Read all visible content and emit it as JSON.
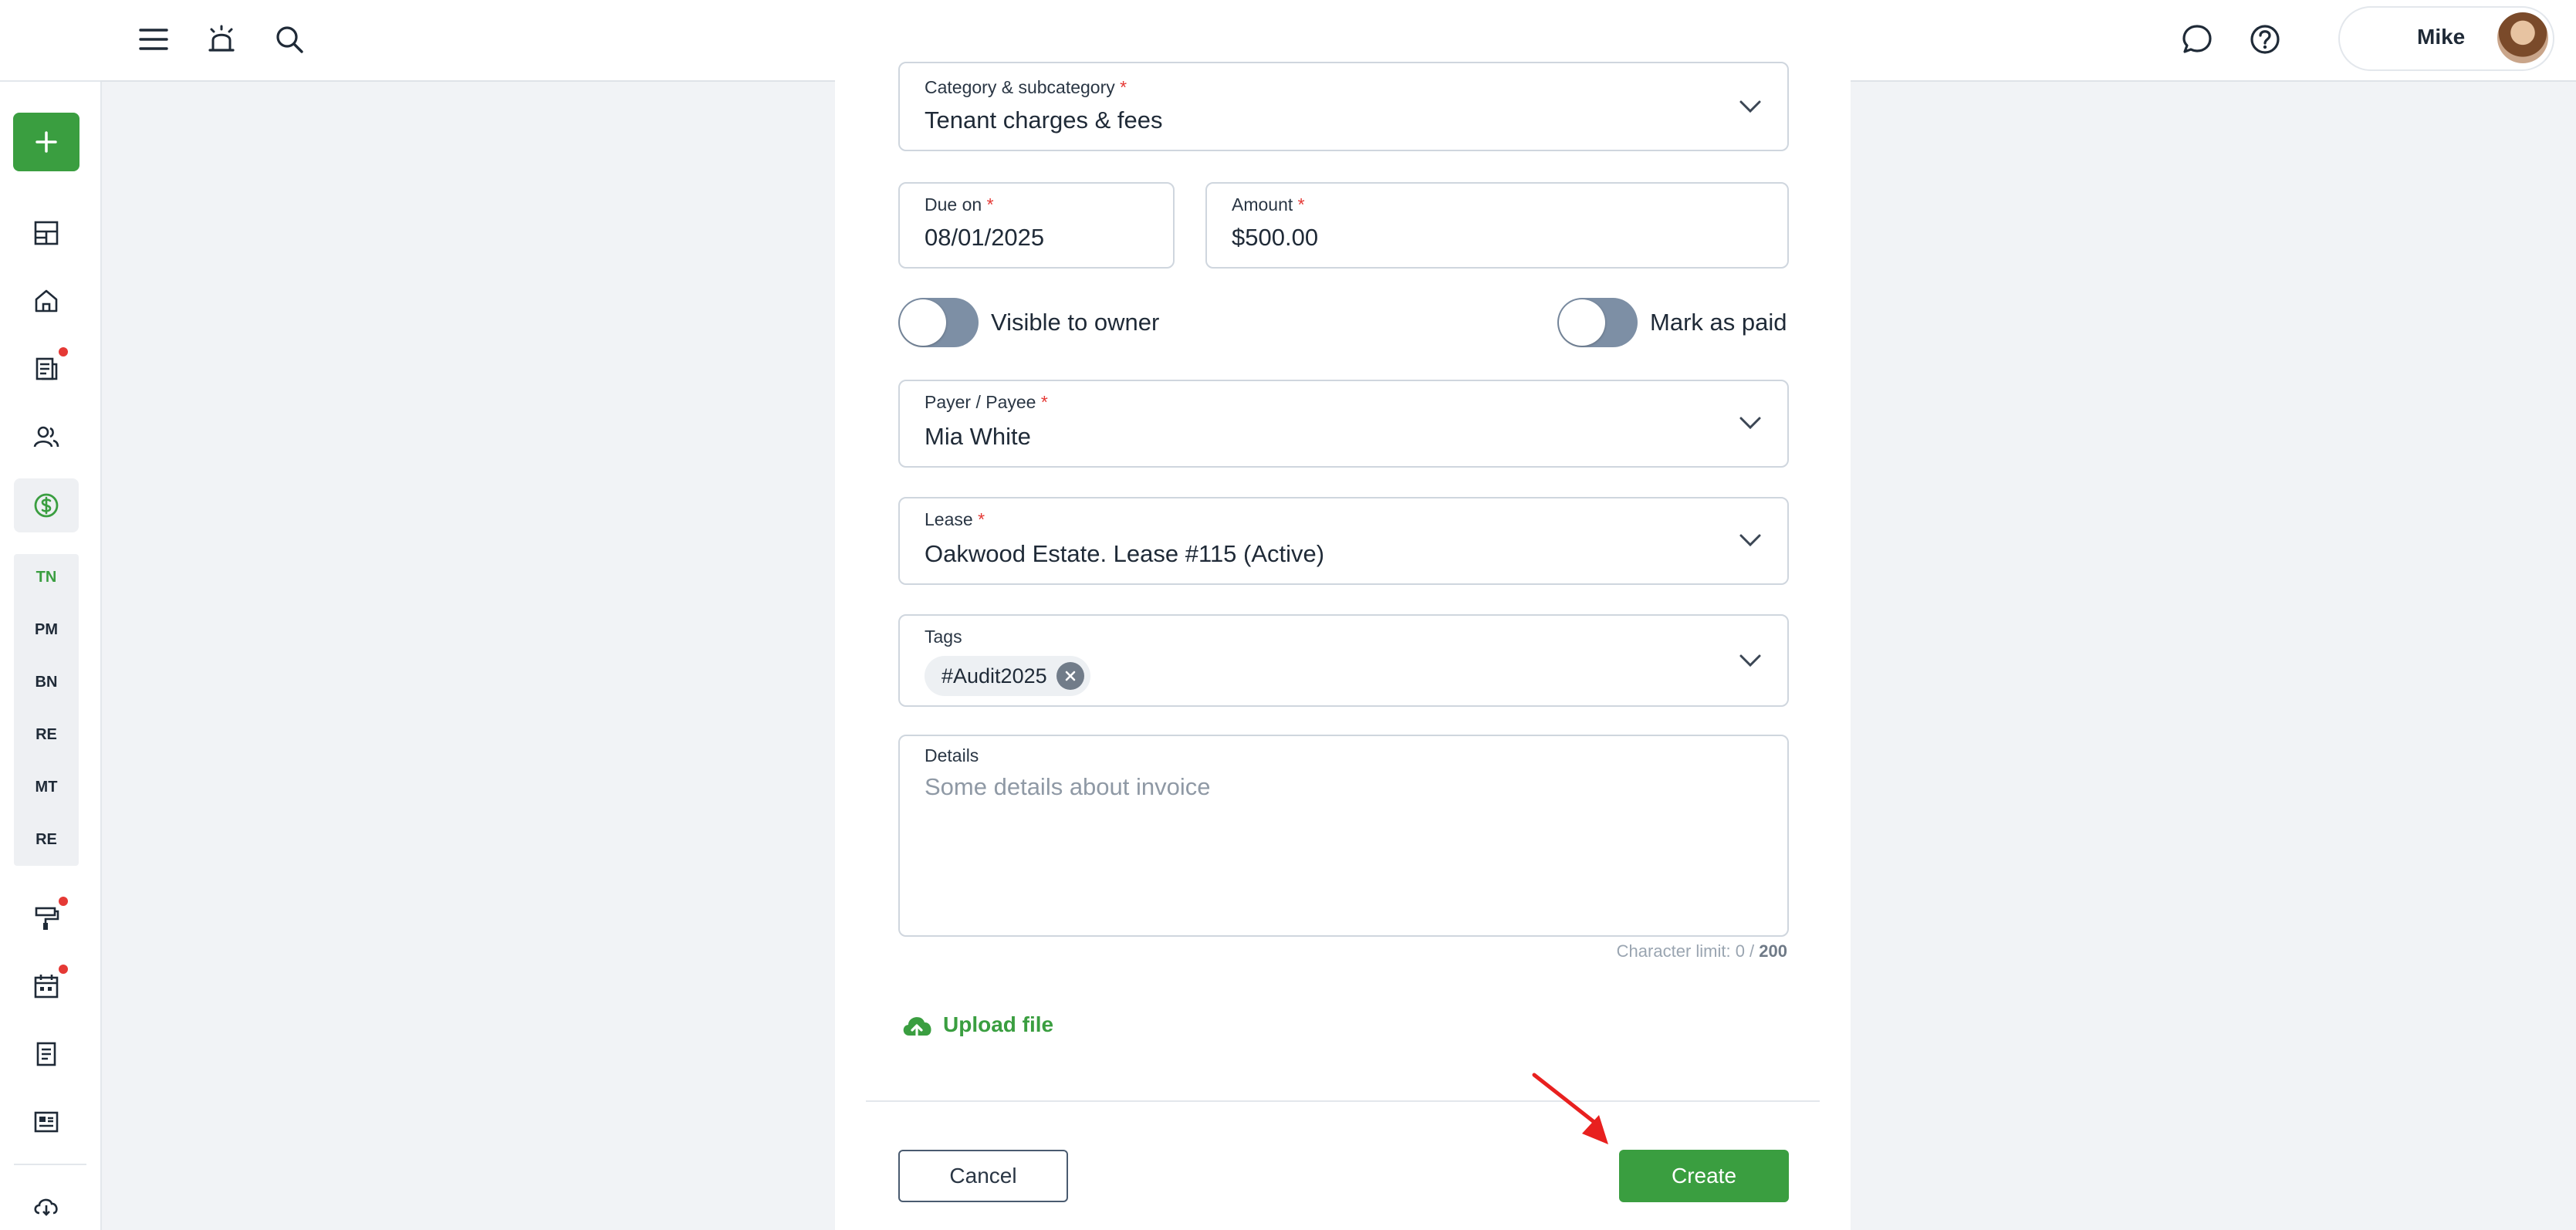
{
  "topbar": {
    "user_name": "Mike"
  },
  "sidebar": {
    "sub_items": [
      "TN",
      "PM",
      "BN",
      "RE",
      "MT",
      "RE"
    ]
  },
  "form": {
    "category": {
      "label": "Category & subcategory",
      "required_mark": "*",
      "value": "Tenant charges & fees"
    },
    "due_on": {
      "label": "Due on",
      "required_mark": "*",
      "value": "08/01/2025"
    },
    "amount": {
      "label": "Amount",
      "required_mark": "*",
      "value": "$500.00"
    },
    "visible_to_owner": {
      "label": "Visible to owner",
      "checked": false
    },
    "mark_as_paid": {
      "label": "Mark as paid",
      "checked": false
    },
    "payer": {
      "label": "Payer / Payee",
      "required_mark": "*",
      "value": "Mia White"
    },
    "lease": {
      "label": "Lease",
      "required_mark": "*",
      "value": "Oakwood Estate. Lease #115 (Active)"
    },
    "tags": {
      "label": "Tags",
      "items": [
        "#Audit2025"
      ]
    },
    "details": {
      "label": "Details",
      "placeholder": "Some details about invoice"
    },
    "char_limit": {
      "prefix": "Character limit: 0 / ",
      "max": "200"
    },
    "upload_label": "Upload file"
  },
  "actions": {
    "cancel_label": "Cancel",
    "create_label": "Create"
  },
  "colors": {
    "accent_green": "#3a9e40",
    "toggle_off": "#7d8fa5",
    "required_red": "#e53935",
    "annotation_arrow": "#e8201f"
  }
}
